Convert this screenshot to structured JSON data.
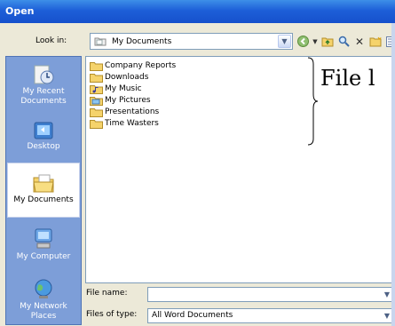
{
  "window": {
    "title": "Open"
  },
  "lookin": {
    "label": "Look in:",
    "value": "My Documents"
  },
  "toolbar": {
    "icons": [
      "back-icon",
      "chevron-down-icon",
      "up-folder-icon",
      "search-web-icon",
      "delete-icon",
      "new-folder-icon",
      "views-icon"
    ]
  },
  "places": [
    {
      "label": "My Recent Documents",
      "icon": "recent-documents-icon"
    },
    {
      "label": "Desktop",
      "icon": "desktop-icon"
    },
    {
      "label": "My Documents",
      "icon": "my-documents-icon",
      "selected": true
    },
    {
      "label": "My Computer",
      "icon": "my-computer-icon"
    },
    {
      "label": "My Network Places",
      "icon": "network-places-icon"
    }
  ],
  "files": [
    {
      "name": "Company Reports",
      "icon": "folder-icon"
    },
    {
      "name": "Downloads",
      "icon": "folder-icon"
    },
    {
      "name": "My Music",
      "icon": "music-folder-icon"
    },
    {
      "name": "My Pictures",
      "icon": "pictures-folder-icon"
    },
    {
      "name": "Presentations",
      "icon": "folder-icon"
    },
    {
      "name": "Time Wasters",
      "icon": "folder-icon"
    }
  ],
  "annotation": {
    "text": "File l"
  },
  "filename": {
    "label": "File name:",
    "value": ""
  },
  "filetype": {
    "label": "Files of type:",
    "value": "All Word Documents"
  },
  "colors": {
    "titlebar": "#1d5fd8",
    "places_bar": "#7d9ed8",
    "folder": "#f5d36b"
  }
}
